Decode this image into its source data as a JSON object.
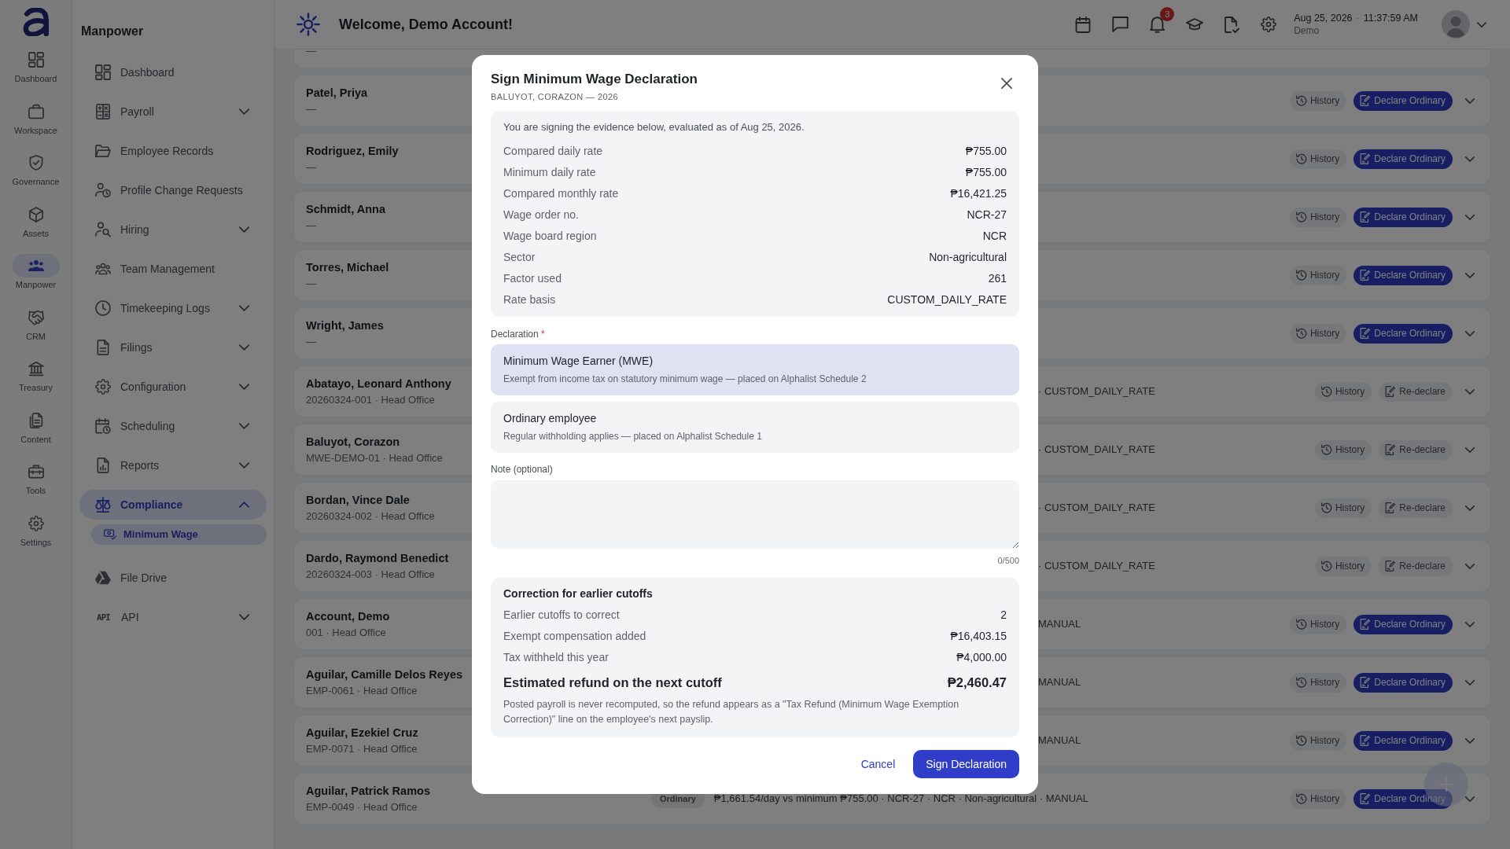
{
  "rail": {
    "items": [
      {
        "label": "Dashboard",
        "selected": false
      },
      {
        "label": "Workspace",
        "selected": false
      },
      {
        "label": "Governance",
        "selected": false
      },
      {
        "label": "Assets",
        "selected": false
      },
      {
        "label": "Manpower",
        "selected": true
      },
      {
        "label": "CRM",
        "selected": false
      },
      {
        "label": "Treasury",
        "selected": false
      },
      {
        "label": "Content",
        "selected": false
      },
      {
        "label": "Tools",
        "selected": false
      },
      {
        "label": "Settings",
        "selected": false
      }
    ]
  },
  "sidebar": {
    "title": "Manpower",
    "items": [
      {
        "label": "Dashboard",
        "kind": "link",
        "selected": false
      },
      {
        "label": "Payroll",
        "kind": "group",
        "expanded": false,
        "selected": false
      },
      {
        "label": "Employee Records",
        "kind": "link",
        "selected": false
      },
      {
        "label": "Profile Change Requests",
        "kind": "link",
        "selected": false
      },
      {
        "label": "Hiring",
        "kind": "group",
        "expanded": false,
        "selected": false
      },
      {
        "label": "Team Management",
        "kind": "link",
        "selected": false
      },
      {
        "label": "Timekeeping Logs",
        "kind": "group",
        "expanded": false,
        "selected": false
      },
      {
        "label": "Filings",
        "kind": "group",
        "expanded": false,
        "selected": false
      },
      {
        "label": "Configuration",
        "kind": "group",
        "expanded": false,
        "selected": false
      },
      {
        "label": "Scheduling",
        "kind": "group",
        "expanded": false,
        "selected": false
      },
      {
        "label": "Reports",
        "kind": "group",
        "expanded": false,
        "selected": false
      },
      {
        "label": "Compliance",
        "kind": "group",
        "expanded": true,
        "selected": true,
        "children": [
          {
            "label": "Minimum Wage",
            "selected": true
          }
        ]
      },
      {
        "label": "File Drive",
        "kind": "link",
        "selected": false
      },
      {
        "label": "API",
        "kind": "group",
        "expanded": false,
        "selected": false,
        "icon_text": "API"
      }
    ]
  },
  "header": {
    "title": "Welcome, Demo Account!",
    "notification_count": "3",
    "date": "Aug 25, 2026",
    "separator": "·",
    "time": "11:37:59 AM",
    "user": "Demo"
  },
  "employees": [
    {
      "sub": "—"
    },
    {
      "name": "Patel, Priya",
      "sub": "—",
      "actions": [
        {
          "label": "History",
          "kind": "history"
        },
        {
          "label": "Declare Ordinary",
          "kind": "declare"
        }
      ],
      "expanded": false
    },
    {
      "name": "Rodriguez, Emily",
      "sub": "—",
      "actions": [
        {
          "label": "History",
          "kind": "history"
        },
        {
          "label": "Declare Ordinary",
          "kind": "declare"
        }
      ],
      "expanded": false
    },
    {
      "name": "Schmidt, Anna",
      "sub": "—",
      "actions": [
        {
          "label": "History",
          "kind": "history"
        },
        {
          "label": "Declare Ordinary",
          "kind": "declare"
        }
      ],
      "expanded": false
    },
    {
      "name": "Torres, Michael",
      "sub": "—",
      "actions": [
        {
          "label": "History",
          "kind": "history"
        },
        {
          "label": "Declare Ordinary",
          "kind": "declare"
        }
      ],
      "expanded": false
    },
    {
      "name": "Wright, James",
      "sub": "—",
      "actions": [
        {
          "label": "History",
          "kind": "history"
        },
        {
          "label": "Declare Ordinary",
          "kind": "declare"
        }
      ],
      "expanded": false
    },
    {
      "name": "Abatayo, Leonard Anthony",
      "sub": "20260324-001 · Head Office",
      "detail": "· CUSTOM_DAILY_RATE",
      "actions": [
        {
          "label": "History",
          "kind": "history"
        },
        {
          "label": "Re-declare",
          "kind": "redeclare"
        }
      ],
      "expanded": false
    },
    {
      "name": "Baluyot, Corazon",
      "sub": "MWE-DEMO-01 · Head Office",
      "detail": "· CUSTOM_DAILY_RATE",
      "actions": [
        {
          "label": "History",
          "kind": "history"
        },
        {
          "label": "Re-declare",
          "kind": "redeclare"
        }
      ],
      "expanded": false
    },
    {
      "name": "Bordan, Vince Dale",
      "sub": "20260324-002 · Head Office",
      "detail": "· CUSTOM_DAILY_RATE",
      "actions": [
        {
          "label": "History",
          "kind": "history"
        },
        {
          "label": "Re-declare",
          "kind": "redeclare"
        }
      ],
      "expanded": false
    },
    {
      "name": "Dardo, Raymond Benedict",
      "sub": "20260324-003 · Head Office",
      "detail": "· CUSTOM_DAILY_RATE",
      "actions": [
        {
          "label": "History",
          "kind": "history"
        },
        {
          "label": "Re-declare",
          "kind": "redeclare"
        }
      ],
      "expanded": false
    },
    {
      "name": "Account, Demo",
      "sub": "001 · Head Office",
      "detail": "MANUAL",
      "actions": [
        {
          "label": "History",
          "kind": "history"
        },
        {
          "label": "Declare Ordinary",
          "kind": "declare"
        }
      ],
      "expanded": false
    },
    {
      "name": "Aguilar, Camille Delos Reyes",
      "sub": "EMP-0061 · Head Office",
      "detail": "MANUAL",
      "actions": [
        {
          "label": "History",
          "kind": "history"
        },
        {
          "label": "Declare Ordinary",
          "kind": "declare"
        }
      ],
      "expanded": false
    },
    {
      "name": "Aguilar, Ezekiel Cruz",
      "sub": "EMP-0071 · Head Office",
      "detail": "MANUAL",
      "actions": [
        {
          "label": "History",
          "kind": "history"
        },
        {
          "label": "Declare Ordinary",
          "kind": "declare"
        }
      ],
      "expanded": false
    },
    {
      "name": "Aguilar, Patrick Ramos",
      "sub": "EMP-0049 · Head Office",
      "badge": "Ordinary",
      "detail": "₱1,661.54/day vs minimum ₱755.00 · NCR-27 · NCR · Non-agricultural · MANUAL",
      "actions": [
        {
          "label": "History",
          "kind": "history"
        },
        {
          "label": "Declare Ordinary",
          "kind": "declare"
        }
      ],
      "expanded": false
    }
  ],
  "dialog": {
    "title": "Sign Minimum Wage Declaration",
    "subtitle": "BALUYOT, CORAZON — 2026",
    "intro": "You are signing the evidence below, evaluated as of Aug 25, 2026.",
    "evidence": [
      {
        "label": "Compared daily rate",
        "value": "₱755.00"
      },
      {
        "label": "Minimum daily rate",
        "value": "₱755.00"
      },
      {
        "label": "Compared monthly rate",
        "value": "₱16,421.25"
      },
      {
        "label": "Wage order no.",
        "value": "NCR-27"
      },
      {
        "label": "Wage board region",
        "value": "NCR"
      },
      {
        "label": "Sector",
        "value": "Non-agricultural"
      },
      {
        "label": "Factor used",
        "value": "261"
      },
      {
        "label": "Rate basis",
        "value": "CUSTOM_DAILY_RATE"
      }
    ],
    "declaration_label": "Declaration",
    "required_mark": "*",
    "options": [
      {
        "title": "Minimum Wage Earner (MWE)",
        "description": "Exempt from income tax on statutory minimum wage — placed on Alphalist Schedule 2",
        "selected": true
      },
      {
        "title": "Ordinary employee",
        "description": "Regular withholding applies — placed on Alphalist Schedule 1",
        "selected": false
      }
    ],
    "note_label": "Note (optional)",
    "note_counter": "0/500",
    "correction": {
      "title": "Correction for earlier cutoffs",
      "rows": [
        {
          "label": "Earlier cutoffs to correct",
          "value": "2"
        },
        {
          "label": "Exempt compensation added",
          "value": "₱16,403.15"
        },
        {
          "label": "Tax withheld this year",
          "value": "₱4,000.00"
        }
      ],
      "total": {
        "label": "Estimated refund on the next cutoff",
        "value": "₱2,460.47"
      },
      "note": "Posted payroll is never recomputed, so the refund appears as a \"Tax Refund (Minimum Wage Exemption Correction)\" line on the employee's next payslip."
    },
    "buttons": [
      {
        "label": "Cancel",
        "kind": "text"
      },
      {
        "label": "Sign Declaration",
        "kind": "primary"
      }
    ]
  }
}
